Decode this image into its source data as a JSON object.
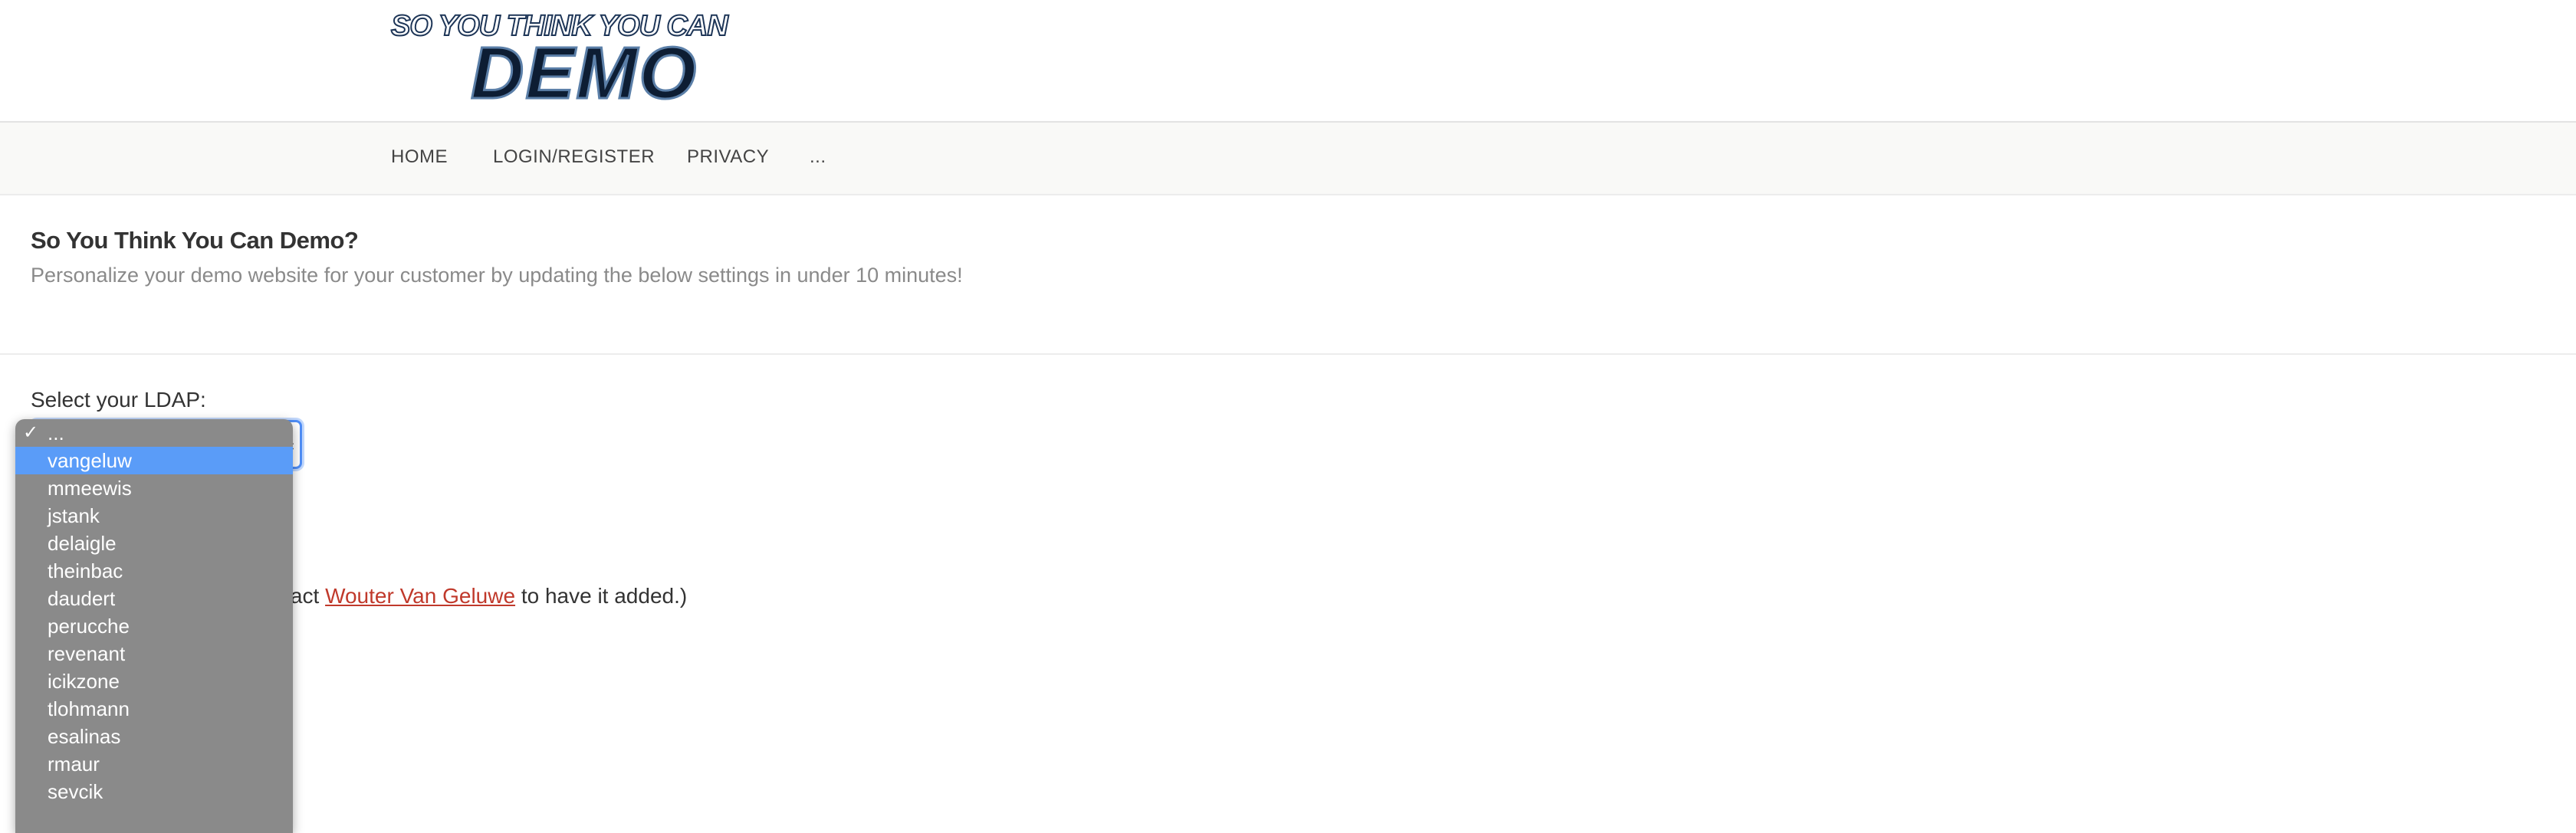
{
  "logo": {
    "top_line": "SO YOU THINK YOU CAN",
    "main": "DEMO"
  },
  "nav": [
    "HOME",
    "LOGIN/REGISTER",
    "PRIVACY",
    "..."
  ],
  "intro": {
    "title": "So You Think You Can Demo?",
    "subtitle": "Personalize your demo website for your customer by updating the below settings in under 10 minutes!"
  },
  "form": {
    "label": "Select your LDAP:",
    "selected_value": "...",
    "help_prefix": "ontact ",
    "help_link": "Wouter Van Geluwe",
    "help_suffix": " to have it added.)"
  },
  "dropdown": {
    "checked_option": "...",
    "highlighted_option": "vangeluw",
    "options": [
      "...",
      "vangeluw",
      "mmeewis",
      "jstank",
      "delaigle",
      "theinbac",
      "daudert",
      "perucche",
      "revenant",
      "icikzone",
      "tlohmann",
      "esalinas",
      "rmaur",
      "sevcik"
    ]
  },
  "colors": {
    "highlight": "#5a9cf8",
    "focus_ring": "#4f8ef7",
    "link": "#c0392b",
    "dropdown_bg": "#8a8a8a"
  }
}
